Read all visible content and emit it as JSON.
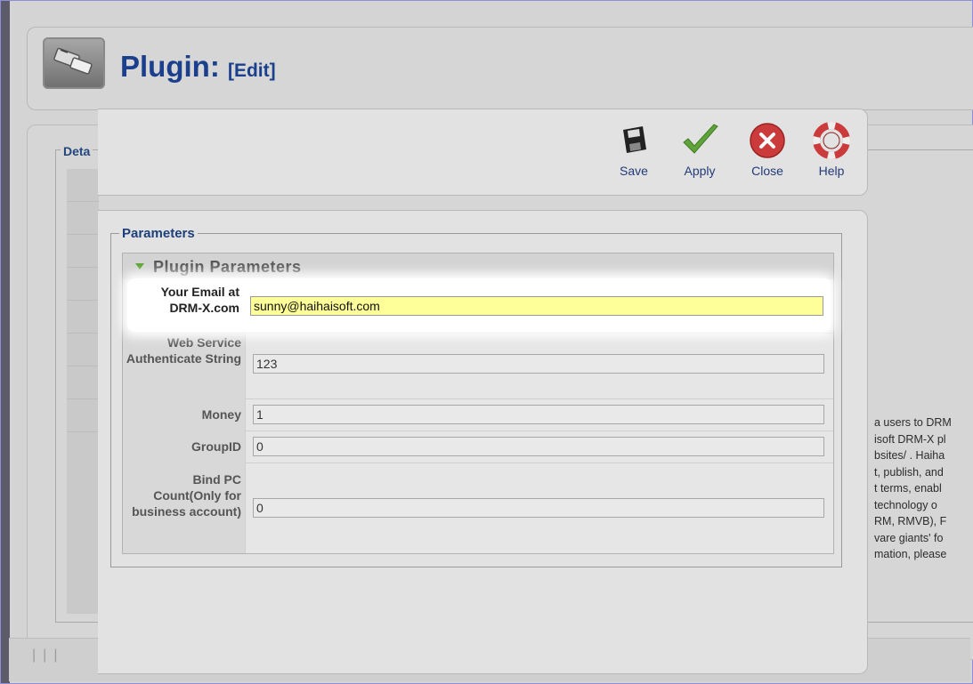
{
  "header": {
    "title": "Plugin:",
    "subtitle": "[Edit]"
  },
  "details": {
    "legend_partial": "Deta"
  },
  "toolbar": {
    "buttons": [
      {
        "id": "save",
        "label": "Save",
        "icon": "floppy-disk-icon"
      },
      {
        "id": "apply",
        "label": "Apply",
        "icon": "checkmark-icon"
      },
      {
        "id": "close",
        "label": "Close",
        "icon": "close-x-icon"
      },
      {
        "id": "help",
        "label": "Help",
        "icon": "lifebuoy-icon"
      }
    ]
  },
  "parameters": {
    "legend": "Parameters",
    "section_title": "Plugin Parameters",
    "fields": [
      {
        "label": "Your Email at DRM-X.com",
        "value": "sunny@haihaisoft.com",
        "highlighted": true
      },
      {
        "label": "Web Service Authenticate String",
        "value": "123"
      },
      {
        "label": "Money",
        "value": "1"
      },
      {
        "label": "GroupID",
        "value": "0"
      },
      {
        "label": "Bind PC Count(Only for business account)",
        "value": "0"
      }
    ]
  },
  "description_lines": [
    "a users to DRM",
    "isoft DRM-X pl",
    "bsites/ . Haiha",
    "t, publish, and",
    "t terms, enabl",
    "technology o",
    "RM, RMVB), F",
    "vare giants' fo",
    "mation, please"
  ],
  "colors": {
    "title": "#1a3f8c",
    "highlight_input": "#ffff99",
    "arrow": "#5aa332"
  }
}
